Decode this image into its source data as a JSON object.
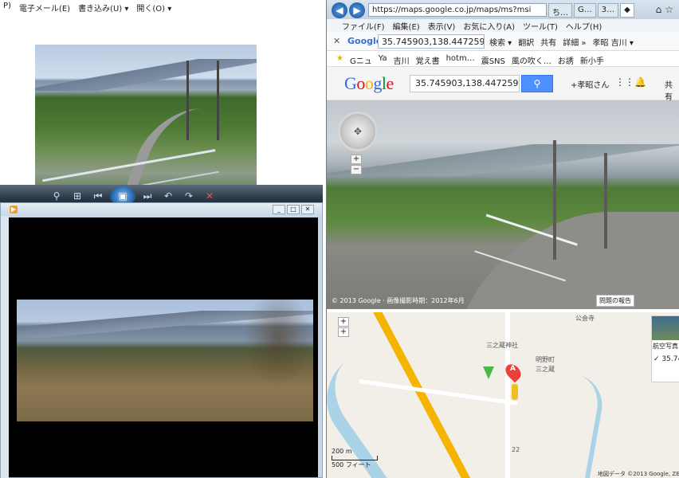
{
  "left_window": {
    "menu": [
      "P)",
      "電子メール(E)",
      "書き込み(U) ▾",
      "開く(O) ▾"
    ]
  },
  "viewer_toolbar": {
    "icons": [
      "zoom-icon",
      "fit-icon",
      "prev-icon",
      "slideshow-icon",
      "next-icon",
      "rotate-left-icon",
      "rotate-right-icon",
      "delete-icon"
    ]
  },
  "video_window": {
    "controls": [
      "_",
      "□",
      "✕"
    ]
  },
  "browser": {
    "url": "https://maps.google.co.jp/maps/ms?msi",
    "tabs": [
      "ち…",
      "G…",
      "3…",
      "◆"
    ],
    "menu": [
      "ファイル(F)",
      "編集(E)",
      "表示(V)",
      "お気に入り(A)",
      "ツール(T)",
      "ヘルプ(H)"
    ],
    "toolbar": {
      "search_value": "35.745903,138.447259",
      "items": [
        "検索 ▾",
        "翻訳",
        "共有",
        "詳細 »",
        "孝昭 吉川 ▾"
      ]
    },
    "favorites": [
      "Gニュ",
      "Ya",
      "吉川",
      "覚え書",
      "hotm…",
      "震SNS",
      "風の吹く…",
      "お誘",
      "新小手"
    ],
    "maps": {
      "search_value": "35.745903,138.447259",
      "user": "+孝昭さん",
      "share": "共有"
    },
    "streetview": {
      "credit": "© 2013 Google · 画像撮影時期：2012年6月",
      "report": "問題の報告"
    },
    "map": {
      "labels": [
        "三之蔵神社",
        "明野町",
        "三之蔵",
        "公会寺",
        "22",
        "200 m",
        "500 フィート"
      ],
      "attribution": "地図データ ©2013 Google, ZENRIN",
      "satellite": "航空写真",
      "coord": "✓ 35.74",
      "pin_letter": "A"
    }
  }
}
